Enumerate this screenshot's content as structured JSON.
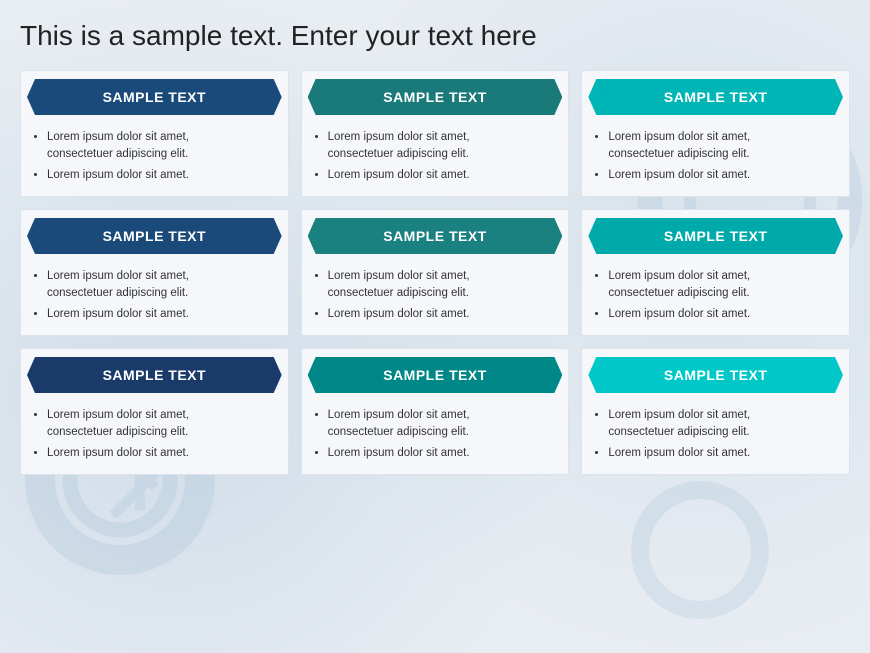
{
  "page": {
    "title": "This is a sample text. Enter your text here"
  },
  "cards": [
    {
      "id": "card-1",
      "header_label": "SAMPLE TEXT",
      "header_class": "header-dark-blue",
      "bullet1_line1": "Lorem ipsum dolor sit amet,",
      "bullet1_line2": "consectetuer adipiscing elit.",
      "bullet2": "Lorem ipsum dolor sit amet."
    },
    {
      "id": "card-2",
      "header_label": "SAMPLE TEXT",
      "header_class": "header-teal-dark",
      "bullet1_line1": "Lorem ipsum dolor sit amet,",
      "bullet1_line2": "consectetuer adipiscing elit.",
      "bullet2": "Lorem ipsum dolor sit amet."
    },
    {
      "id": "card-3",
      "header_label": "SAMPLE TEXT",
      "header_class": "header-teal-light",
      "bullet1_line1": "Lorem ipsum dolor sit amet,",
      "bullet1_line2": "consectetuer adipiscing elit.",
      "bullet2": "Lorem ipsum dolor sit amet."
    },
    {
      "id": "card-4",
      "header_label": "SAMPLE TEXT",
      "header_class": "header-blue2",
      "bullet1_line1": "Lorem ipsum dolor sit amet,",
      "bullet1_line2": "consectetuer adipiscing elit.",
      "bullet2": "Lorem ipsum dolor sit amet."
    },
    {
      "id": "card-5",
      "header_label": "SAMPLE TEXT",
      "header_class": "header-teal2",
      "bullet1_line1": "Lorem ipsum dolor sit amet,",
      "bullet1_line2": "consectetuer adipiscing elit.",
      "bullet2": "Lorem ipsum dolor sit amet."
    },
    {
      "id": "card-6",
      "header_label": "SAMPLE TEXT",
      "header_class": "header-teal-light2",
      "bullet1_line1": "Lorem ipsum dolor sit amet,",
      "bullet1_line2": "consectetuer adipiscing elit.",
      "bullet2": "Lorem ipsum dolor sit amet."
    },
    {
      "id": "card-7",
      "header_label": "SAMPLE TEXT",
      "header_class": "header-blue3",
      "bullet1_line1": "Lorem ipsum dolor sit amet,",
      "bullet1_line2": "consectetuer adipiscing elit.",
      "bullet2": "Lorem ipsum dolor sit amet."
    },
    {
      "id": "card-8",
      "header_label": "SAMPLE TEXT",
      "header_class": "header-teal3",
      "bullet1_line1": "Lorem ipsum dolor sit amet,",
      "bullet1_line2": "consectetuer adipiscing elit.",
      "bullet2": "Lorem ipsum dolor sit amet."
    },
    {
      "id": "card-9",
      "header_label": "SAMPLE TEXT",
      "header_class": "header-teal-light3",
      "bullet1_line1": "Lorem ipsum dolor sit amet,",
      "bullet1_line2": "consectetuer adipiscing elit.",
      "bullet2": "Lorem ipsum dolor sit amet."
    }
  ]
}
